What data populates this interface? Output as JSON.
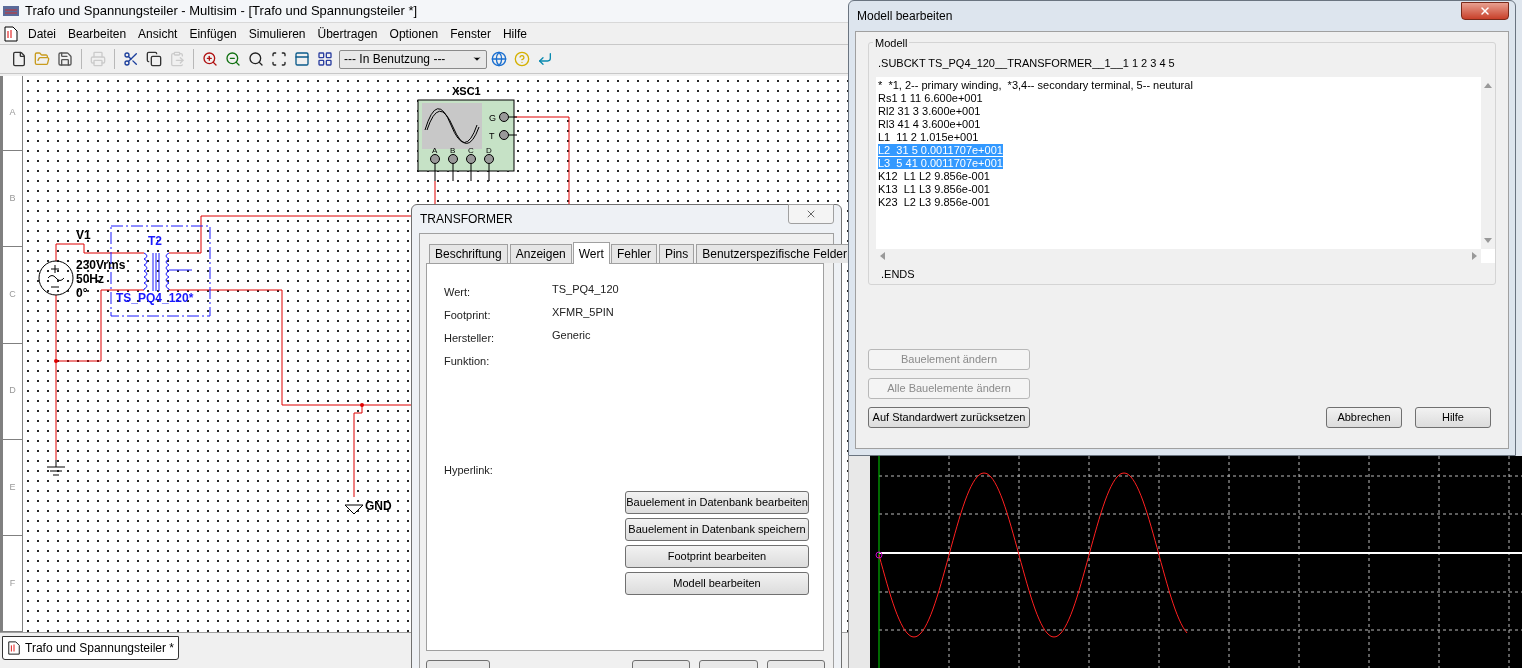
{
  "main_window": {
    "title": "Trafo und Spannungsteiler - Multisim - [Trafo und Spannungsteiler *]",
    "menu": [
      "Datei",
      "Bearbeiten",
      "Ansicht",
      "Einfügen",
      "Simulieren",
      "Übertragen",
      "Optionen",
      "Fenster",
      "Hilfe"
    ],
    "toolbar": {
      "groups": [
        [
          {
            "kind": "new",
            "disabled": false
          },
          {
            "kind": "open",
            "disabled": false
          },
          {
            "kind": "save",
            "disabled": false
          }
        ],
        [
          {
            "kind": "print",
            "disabled": true
          }
        ],
        [
          {
            "kind": "cut",
            "disabled": false
          },
          {
            "kind": "copy",
            "disabled": false
          },
          {
            "kind": "paste",
            "disabled": true
          }
        ],
        [
          {
            "kind": "zoom-in",
            "disabled": false
          },
          {
            "kind": "zoom-out",
            "disabled": false
          },
          {
            "kind": "zoom-area",
            "disabled": false
          },
          {
            "kind": "zoom-fit",
            "disabled": false
          },
          {
            "kind": "sheet",
            "disabled": false
          },
          {
            "kind": "grid",
            "disabled": false
          }
        ]
      ],
      "dropdown": "--- In Benutzung ---",
      "icons_after": [
        {
          "kind": "globe",
          "disabled": false
        },
        {
          "kind": "help",
          "disabled": false
        },
        {
          "kind": "back",
          "disabled": false
        }
      ]
    },
    "ruler": [
      "A",
      "B",
      "C",
      "D",
      "E",
      "F"
    ],
    "schematic": {
      "source": {
        "name": "V1",
        "voltage": "230Vrms",
        "frequency": "50Hz",
        "phase": "0°"
      },
      "transformer": {
        "name": "T2",
        "model": "TS_PQ4_120*"
      },
      "scope": {
        "name": "XSC1",
        "side_pins": [
          "G",
          "T"
        ],
        "bottom_pins": [
          "A",
          "B",
          "C",
          "D"
        ]
      },
      "ground": {
        "label": "GND"
      }
    },
    "document_tabs": [
      {
        "label": "Trafo und Spannungsteiler *",
        "selected": true
      }
    ]
  },
  "transformer_dialog": {
    "title": "TRANSFORMER",
    "tabs": [
      {
        "label": "Beschriftung",
        "selected": false
      },
      {
        "label": "Anzeigen",
        "selected": false
      },
      {
        "label": "Wert",
        "selected": true
      },
      {
        "label": "Fehler",
        "selected": false
      },
      {
        "label": "Pins",
        "selected": false
      },
      {
        "label": "Benutzerspezifische Felder",
        "selected": false
      }
    ],
    "fields": [
      {
        "label": "Wert:",
        "value": "TS_PQ4_120"
      },
      {
        "label": "Footprint:",
        "value": "XFMR_5PIN"
      },
      {
        "label": "Hersteller:",
        "value": "Generic"
      },
      {
        "label": "Funktion:"
      },
      {
        "label": "Hyperlink:"
      }
    ],
    "buttons": [
      "Bauelement in Datenbank bearbeiten",
      "Bauelement in Datenbank speichern",
      "Footprint bearbeiten",
      "Modell bearbeiten"
    ]
  },
  "model_dialog": {
    "title": "Modell bearbeiten",
    "group": "Modell",
    "header": ".SUBCKT TS_PQ4_120__TRANSFORMER__1__1 1 2 3 4 5",
    "lines": [
      {
        "text": "*  *1, 2-- primary winding,  *3,4-- secondary terminal, 5-- neutural",
        "selected": false
      },
      {
        "text": "Rs1 1 11 6.600e+001",
        "selected": false
      },
      {
        "text": "Rl2 31 3 3.600e+001",
        "selected": false
      },
      {
        "text": "Rl3 41 4 3.600e+001",
        "selected": false
      },
      {
        "text": "L1  11 2 1.015e+001",
        "selected": false
      },
      {
        "text": "L2  31 5 0.0011707e+001",
        "selected": true
      },
      {
        "text": "L3  5 41 0.0011707e+001",
        "selected": true
      },
      {
        "text": "K12  L1 L2 9.856e-001",
        "selected": false
      },
      {
        "text": "K13  L1 L3 9.856e-001",
        "selected": false
      },
      {
        "text": "K23  L2 L3 9.856e-001",
        "selected": false
      }
    ],
    "footer": ".ENDS",
    "buttons_left": [
      {
        "label": "Bauelement ändern",
        "disabled": true
      },
      {
        "label": "Alle Bauelemente ändern",
        "disabled": true
      },
      {
        "label": "Auf Standardwert zurücksetzen",
        "disabled": false
      }
    ],
    "buttons_right": [
      {
        "label": "Abbrechen",
        "disabled": false
      },
      {
        "label": "Hilfe",
        "disabled": false
      }
    ]
  }
}
